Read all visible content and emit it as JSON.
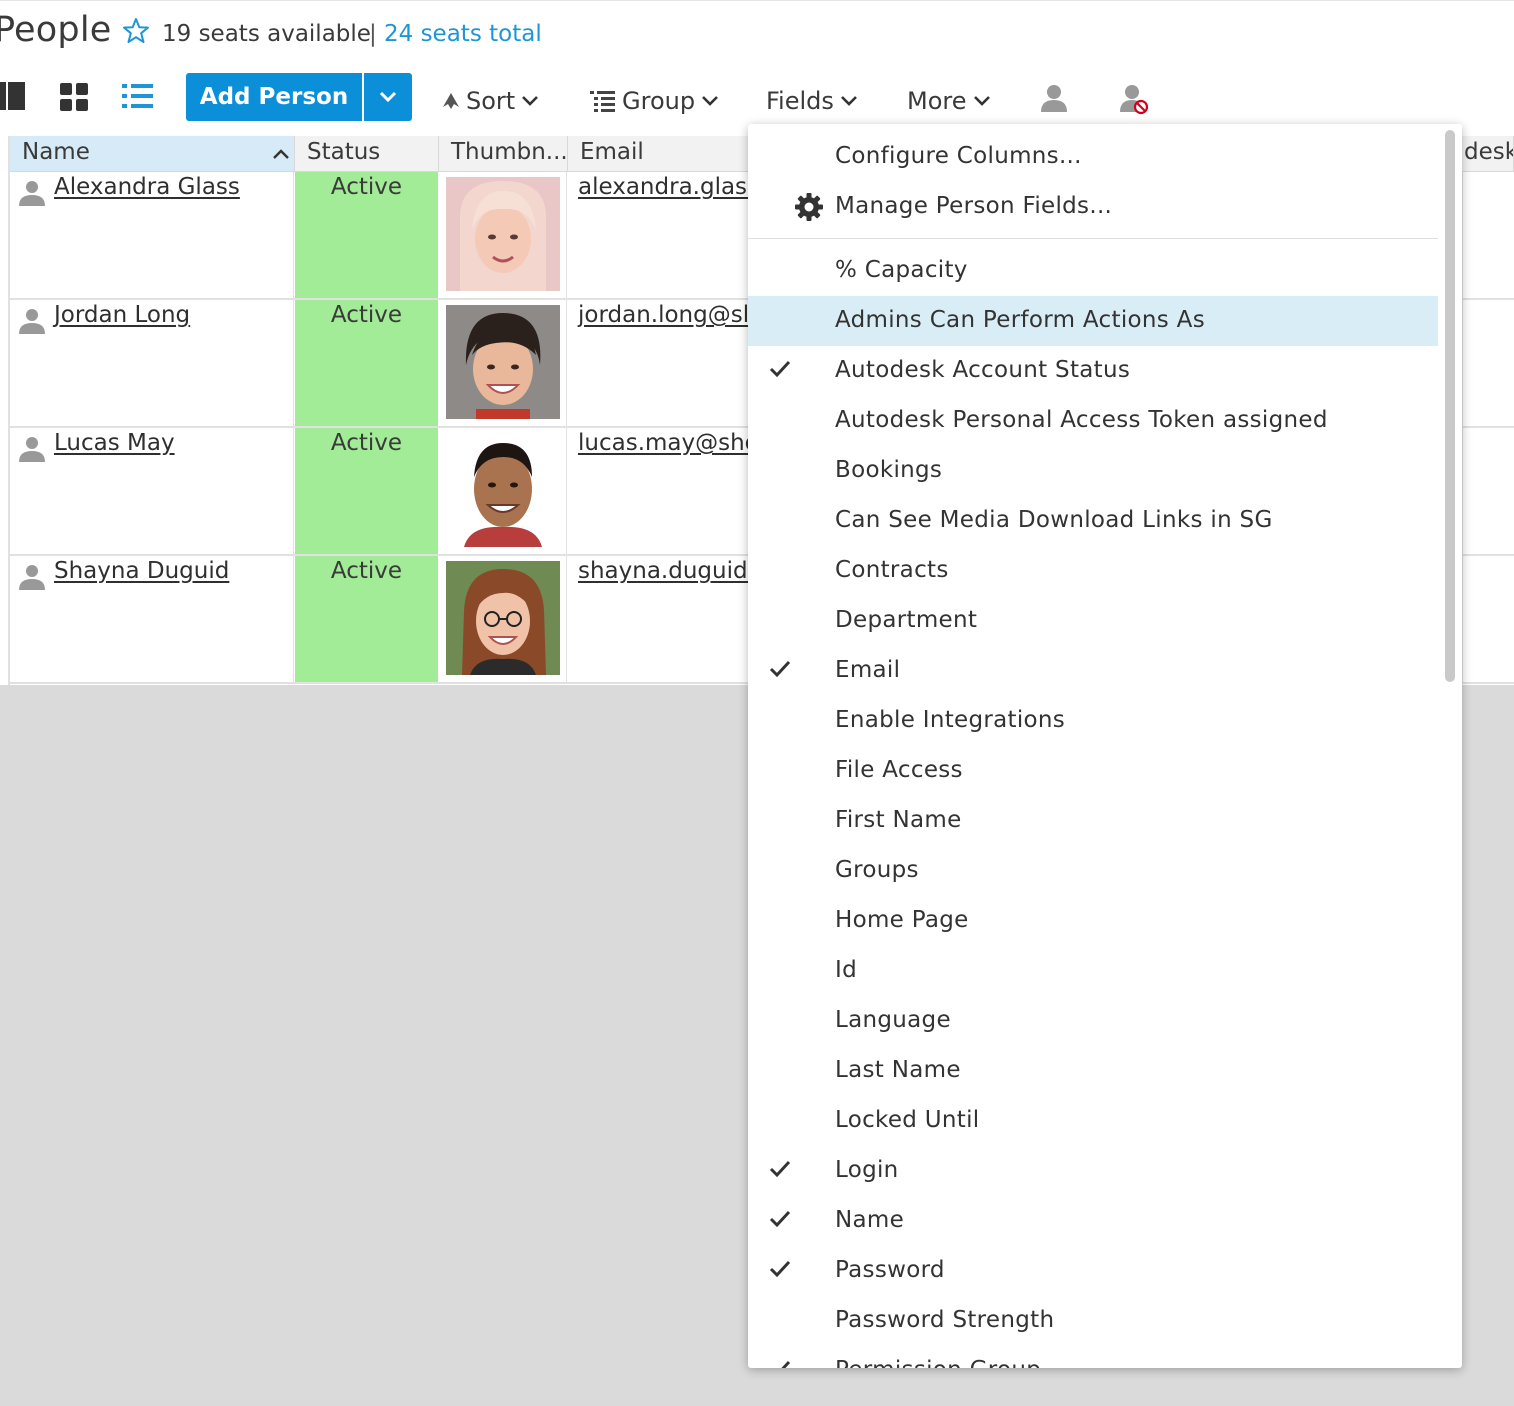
{
  "header": {
    "title": "People",
    "seats_available": "19 seats available",
    "separator": "|",
    "seats_total": "24 seats total"
  },
  "toolbar": {
    "add_person": "Add Person",
    "sort": "Sort",
    "group": "Group",
    "fields": "Fields",
    "more": "More"
  },
  "columns": {
    "name": "Name",
    "status": "Status",
    "thumbnail": "Thumbn...",
    "email": "Email",
    "autodesk_partial": "desk"
  },
  "rows": [
    {
      "name": "Alexandra Glass",
      "status": "Active",
      "email": "alexandra.glass"
    },
    {
      "name": "Jordan Long",
      "status": "Active",
      "email": "jordan.long@sl"
    },
    {
      "name": "Lucas May",
      "status": "Active",
      "email": "lucas.may@sho"
    },
    {
      "name": "Shayna Duguid",
      "status": "Active",
      "email": "shayna.duguid@"
    }
  ],
  "fields_menu": {
    "configure_columns": "Configure Columns...",
    "manage_fields": "Manage Person Fields...",
    "items": [
      {
        "label": "% Capacity",
        "checked": false
      },
      {
        "label": "Admins Can Perform Actions As",
        "checked": false,
        "highlighted": true
      },
      {
        "label": "Autodesk Account Status",
        "checked": true
      },
      {
        "label": "Autodesk Personal Access Token assigned",
        "checked": false
      },
      {
        "label": "Bookings",
        "checked": false
      },
      {
        "label": "Can See Media Download Links in SG",
        "checked": false
      },
      {
        "label": "Contracts",
        "checked": false
      },
      {
        "label": "Department",
        "checked": false
      },
      {
        "label": "Email",
        "checked": true
      },
      {
        "label": "Enable Integrations",
        "checked": false
      },
      {
        "label": "File Access",
        "checked": false
      },
      {
        "label": "First Name",
        "checked": false
      },
      {
        "label": "Groups",
        "checked": false
      },
      {
        "label": "Home Page",
        "checked": false
      },
      {
        "label": "Id",
        "checked": false
      },
      {
        "label": "Language",
        "checked": false
      },
      {
        "label": "Last Name",
        "checked": false
      },
      {
        "label": "Locked Until",
        "checked": false
      },
      {
        "label": "Login",
        "checked": true
      },
      {
        "label": "Name",
        "checked": true
      },
      {
        "label": "Password",
        "checked": true
      },
      {
        "label": "Password Strength",
        "checked": false
      },
      {
        "label": "Permission Group",
        "checked": true
      }
    ]
  },
  "colors": {
    "accent": "#0b8fd9",
    "link": "#1e96d6",
    "status_active": "#a2eb97",
    "highlight": "#d9edf7"
  }
}
